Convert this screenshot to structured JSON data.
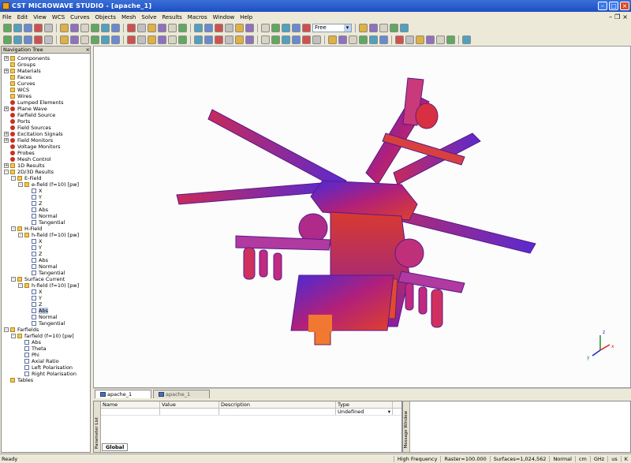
{
  "window": {
    "title": "CST MICROWAVE STUDIO - [apache_1]"
  },
  "menu": [
    "File",
    "Edit",
    "View",
    "WCS",
    "Curves",
    "Objects",
    "Mesh",
    "Solve",
    "Results",
    "Macros",
    "Window",
    "Help"
  ],
  "toolbar": {
    "mode_value": "Free"
  },
  "nav": {
    "title": "Navigation Tree",
    "close": "×",
    "items": [
      {
        "label": "Components",
        "depth": 0,
        "exp": "+",
        "icon": "folder"
      },
      {
        "label": "Groups",
        "depth": 0,
        "exp": "",
        "icon": "folder"
      },
      {
        "label": "Materials",
        "depth": 0,
        "exp": "+",
        "icon": "folder"
      },
      {
        "label": "Faces",
        "depth": 0,
        "exp": "",
        "icon": "folder"
      },
      {
        "label": "Curves",
        "depth": 0,
        "exp": "",
        "icon": "folder"
      },
      {
        "label": "WCS",
        "depth": 0,
        "exp": "",
        "icon": "folder"
      },
      {
        "label": "Wires",
        "depth": 0,
        "exp": "",
        "icon": "folder"
      },
      {
        "label": "Lumped Elements",
        "depth": 0,
        "exp": "",
        "icon": "red"
      },
      {
        "label": "Plane Wave",
        "depth": 0,
        "exp": "+",
        "icon": "red"
      },
      {
        "label": "Farfield Source",
        "depth": 0,
        "exp": "",
        "icon": "red"
      },
      {
        "label": "Ports",
        "depth": 0,
        "exp": "",
        "icon": "red"
      },
      {
        "label": "Field Sources",
        "depth": 0,
        "exp": "",
        "icon": "red"
      },
      {
        "label": "Excitation Signals",
        "depth": 0,
        "exp": "+",
        "icon": "red"
      },
      {
        "label": "Field Monitors",
        "depth": 0,
        "exp": "+",
        "icon": "red"
      },
      {
        "label": "Voltage Monitors",
        "depth": 0,
        "exp": "",
        "icon": "red"
      },
      {
        "label": "Probes",
        "depth": 0,
        "exp": "",
        "icon": "red"
      },
      {
        "label": "Mesh Control",
        "depth": 0,
        "exp": "",
        "icon": "red"
      },
      {
        "label": "1D Results",
        "depth": 0,
        "exp": "+",
        "icon": "folder"
      },
      {
        "label": "2D/3D Results",
        "depth": 0,
        "exp": "-",
        "icon": "folder"
      },
      {
        "label": "E-Field",
        "depth": 1,
        "exp": "-",
        "icon": "folder"
      },
      {
        "label": "e-field (f=10) [pw]",
        "depth": 2,
        "exp": "-",
        "icon": "folder"
      },
      {
        "label": "X",
        "depth": 3,
        "exp": "",
        "icon": "field"
      },
      {
        "label": "Y",
        "depth": 3,
        "exp": "",
        "icon": "field"
      },
      {
        "label": "Z",
        "depth": 3,
        "exp": "",
        "icon": "field"
      },
      {
        "label": "Abs",
        "depth": 3,
        "exp": "",
        "icon": "field"
      },
      {
        "label": "Normal",
        "depth": 3,
        "exp": "",
        "icon": "field"
      },
      {
        "label": "Tangential",
        "depth": 3,
        "exp": "",
        "icon": "field"
      },
      {
        "label": "H-Field",
        "depth": 1,
        "exp": "-",
        "icon": "folder"
      },
      {
        "label": "h-field (f=10) [pw]",
        "depth": 2,
        "exp": "-",
        "icon": "folder"
      },
      {
        "label": "X",
        "depth": 3,
        "exp": "",
        "icon": "field"
      },
      {
        "label": "Y",
        "depth": 3,
        "exp": "",
        "icon": "field"
      },
      {
        "label": "Z",
        "depth": 3,
        "exp": "",
        "icon": "field"
      },
      {
        "label": "Abs",
        "depth": 3,
        "exp": "",
        "icon": "field"
      },
      {
        "label": "Normal",
        "depth": 3,
        "exp": "",
        "icon": "field"
      },
      {
        "label": "Tangential",
        "depth": 3,
        "exp": "",
        "icon": "field"
      },
      {
        "label": "Surface Current",
        "depth": 1,
        "exp": "-",
        "icon": "folder"
      },
      {
        "label": "h-field (f=10) [pw]",
        "depth": 2,
        "exp": "-",
        "icon": "folder"
      },
      {
        "label": "X",
        "depth": 3,
        "exp": "",
        "icon": "field"
      },
      {
        "label": "Y",
        "depth": 3,
        "exp": "",
        "icon": "field"
      },
      {
        "label": "Z",
        "depth": 3,
        "exp": "",
        "icon": "field"
      },
      {
        "label": "Abs",
        "depth": 3,
        "exp": "",
        "icon": "field",
        "selected": true
      },
      {
        "label": "Normal",
        "depth": 3,
        "exp": "",
        "icon": "field"
      },
      {
        "label": "Tangential",
        "depth": 3,
        "exp": "",
        "icon": "field"
      },
      {
        "label": "Farfields",
        "depth": 0,
        "exp": "-",
        "icon": "folder"
      },
      {
        "label": "farfield (f=10) [pw]",
        "depth": 1,
        "exp": "-",
        "icon": "folder"
      },
      {
        "label": "Abs",
        "depth": 2,
        "exp": "",
        "icon": "field"
      },
      {
        "label": "Theta",
        "depth": 2,
        "exp": "",
        "icon": "field"
      },
      {
        "label": "Phi",
        "depth": 2,
        "exp": "",
        "icon": "field"
      },
      {
        "label": "Axial Ratio",
        "depth": 2,
        "exp": "",
        "icon": "field"
      },
      {
        "label": "Left Polarisation",
        "depth": 2,
        "exp": "",
        "icon": "field"
      },
      {
        "label": "Right Polarisation",
        "depth": 2,
        "exp": "",
        "icon": "field"
      },
      {
        "label": "Tables",
        "depth": 0,
        "exp": "",
        "icon": "folder"
      }
    ]
  },
  "tabs": [
    {
      "label": "apache_1",
      "active": true
    },
    {
      "label": "apache_1",
      "active": false
    }
  ],
  "params": {
    "side_label": "Parameter List",
    "headers": [
      "Name",
      "Value",
      "Description",
      "Type"
    ],
    "type_value": "Undefined",
    "tab": "Global"
  },
  "messages": {
    "side_label": "Message Window"
  },
  "axes": {
    "x": "x",
    "y": "y",
    "z": "z"
  },
  "status": {
    "left": "Ready",
    "items": [
      "High Frequency",
      "Raster=100.000",
      "Surfaces=1,024,562",
      "Normal",
      "cm",
      "GHz",
      "us",
      "K"
    ]
  },
  "colors": {
    "accent": "#1d4fc1",
    "field_low": "#3a2ad0",
    "field_mid": "#b4207c",
    "field_high": "#e8501a"
  }
}
